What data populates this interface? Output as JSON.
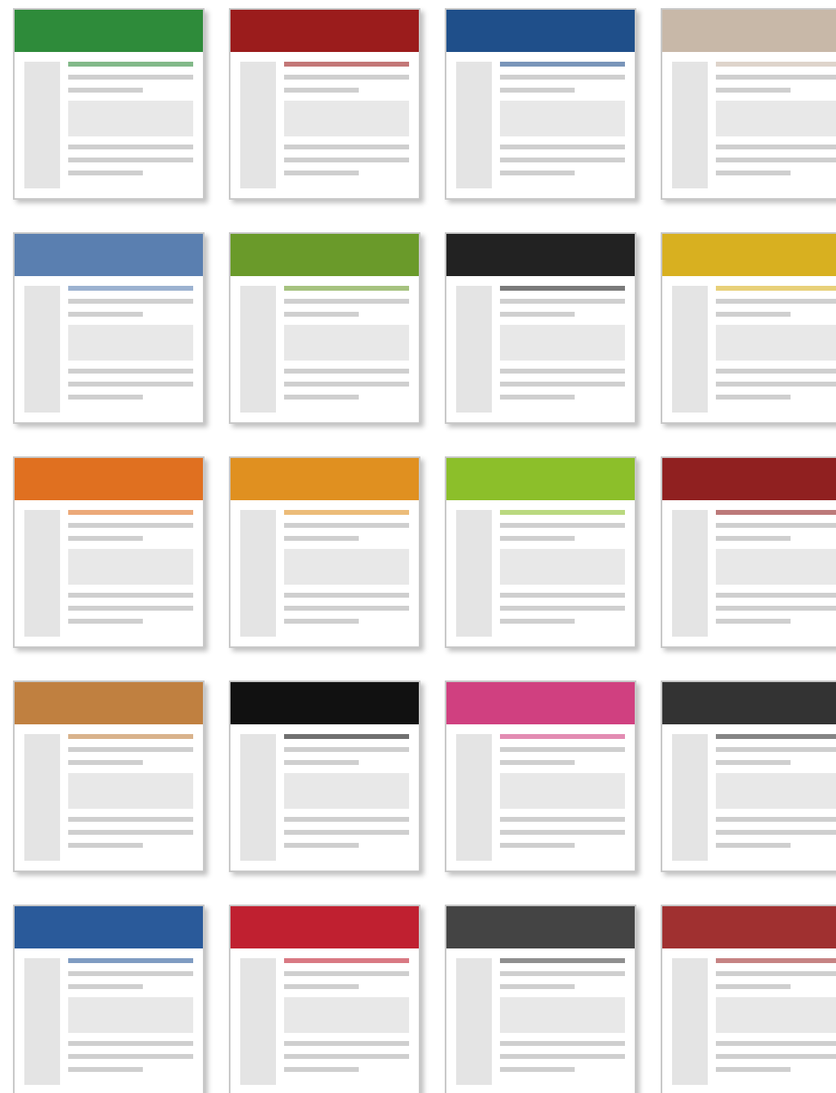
{
  "thumbnails": [
    {
      "color": "#2e8b3a"
    },
    {
      "color": "#9b1c1c"
    },
    {
      "color": "#1f4f8a"
    },
    {
      "color": "#c8b8a8"
    },
    {
      "color": "#5a7fb0"
    },
    {
      "color": "#6a9a2a"
    },
    {
      "color": "#222222"
    },
    {
      "color": "#d8b020"
    },
    {
      "color": "#e07020"
    },
    {
      "color": "#e09020"
    },
    {
      "color": "#8cbf2a"
    },
    {
      "color": "#902020"
    },
    {
      "color": "#c08040"
    },
    {
      "color": "#111111"
    },
    {
      "color": "#d04080"
    },
    {
      "color": "#333333"
    },
    {
      "color": "#2a5a9a"
    },
    {
      "color": "#c02030"
    },
    {
      "color": "#444444"
    },
    {
      "color": "#a03030"
    }
  ]
}
